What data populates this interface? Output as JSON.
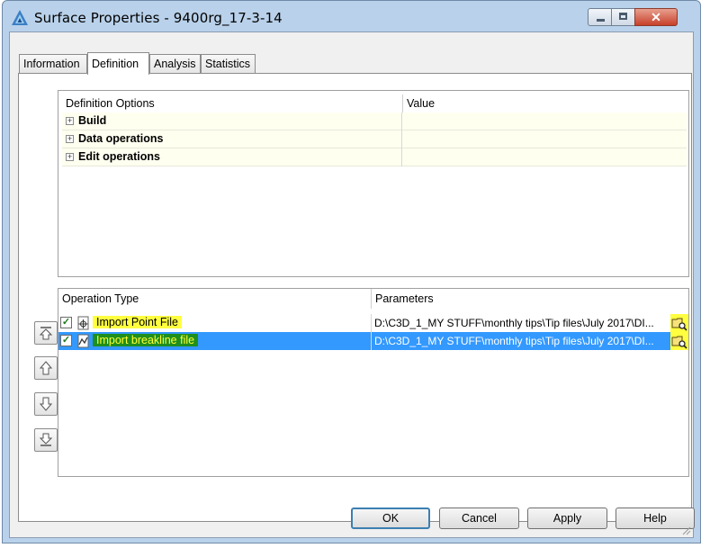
{
  "window": {
    "title": "Surface Properties - 9400rg_17-3-14",
    "close_glyph": "✕"
  },
  "tabs": [
    {
      "label": "Information"
    },
    {
      "label": "Definition",
      "active": true
    },
    {
      "label": "Analysis"
    },
    {
      "label": "Statistics"
    }
  ],
  "definition_options": {
    "headers": {
      "name": "Definition Options",
      "value": "Value"
    },
    "rows": [
      {
        "label": "Build",
        "value": ""
      },
      {
        "label": "Data operations",
        "value": ""
      },
      {
        "label": "Edit operations",
        "value": ""
      }
    ],
    "expand_glyph": "+"
  },
  "operations": {
    "headers": {
      "type": "Operation Type",
      "params": "Parameters"
    },
    "rows": [
      {
        "checked": true,
        "check_glyph": "✓",
        "icon": "point-file-icon",
        "label": "Import Point File",
        "params": "D:\\C3D_1_MY STUFF\\monthly tips\\Tip files\\July 2017\\DI...",
        "highlight": "#ffff40"
      },
      {
        "checked": true,
        "check_glyph": "✓",
        "icon": "breakline-icon",
        "label": "Import breakline file",
        "params": "D:\\C3D_1_MY STUFF\\monthly tips\\Tip files\\July 2017\\DI...",
        "highlight": "#1f8f1f",
        "selected": true
      }
    ]
  },
  "buttons": {
    "ok": "OK",
    "cancel": "Cancel",
    "apply": "Apply",
    "help": "Help"
  },
  "colors": {
    "selection": "#3399ff",
    "option_row_bg": "#fffff0",
    "title_bg": "#b9d1ea"
  }
}
